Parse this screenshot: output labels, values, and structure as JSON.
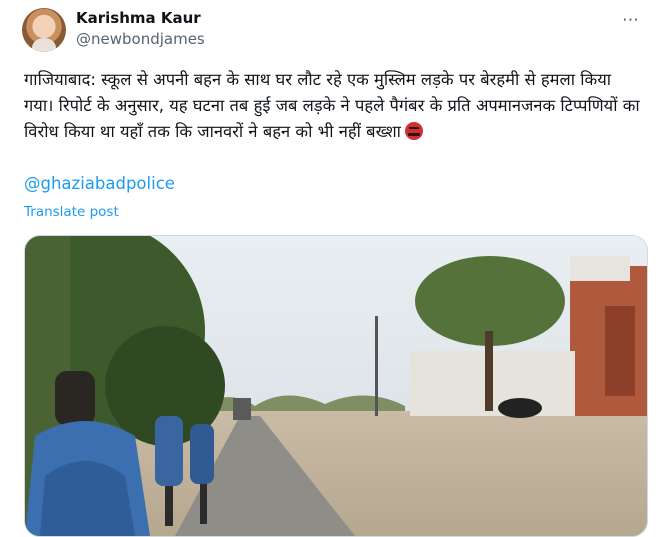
{
  "author": {
    "display_name": "Karishma Kaur",
    "handle": "@newbondjames"
  },
  "tweet": {
    "text": "गाजियाबाद: स्कूल से अपनी बहन के साथ घर लौट रहे एक मुस्लिम लड़के पर बेरहमी से हमला किया गया। रिपोर्ट के अनुसार, यह घटना तब हुई जब लड़के ने पहले पैगंबर के प्रति अपमानजनक टिप्पणियों का विरोध किया था यहाँ तक कि जानवरों ने बहन को भी नहीं बख्शा",
    "emoji": "angry-face-emoji",
    "mention": "@ghaziabadpolice",
    "translate_label": "Translate post"
  },
  "icons": {
    "more": "more-options-icon"
  },
  "colors": {
    "accent": "#1d9bf0",
    "text": "#0f1419",
    "secondary": "#536471",
    "border": "#cfd9de"
  }
}
